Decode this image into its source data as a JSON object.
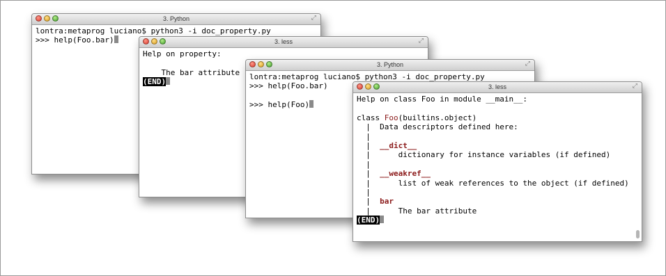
{
  "windows": [
    {
      "title": "3. Python",
      "lines": [
        "lontra:metaprog luciano$ python3 -i doc_property.py",
        ">>> help(Foo.bar)"
      ]
    },
    {
      "title": "3. less",
      "lines": [
        "Help on property:",
        "",
        "    The bar attribute"
      ],
      "end_label": "(END)"
    },
    {
      "title": "3. Python",
      "lines": [
        "lontra:metaprog luciano$ python3 -i doc_property.py",
        ">>> help(Foo.bar)",
        "",
        ">>> help(Foo)"
      ]
    },
    {
      "title": "3. less",
      "header": "Help on class Foo in module __main__:",
      "class_prefix": "class ",
      "class_name": "Foo",
      "class_suffix": "(builtins.object)",
      "bar_char": "|",
      "descriptors_heading": "Data descriptors defined here:",
      "dict_name": "__dict__",
      "dict_desc": "dictionary for instance variables (if defined)",
      "weakref_name": "__weakref__",
      "weakref_desc": "list of weak references to the object (if defined)",
      "bar_name": "bar",
      "bar_desc": "The bar attribute",
      "end_label": "(END)"
    }
  ]
}
